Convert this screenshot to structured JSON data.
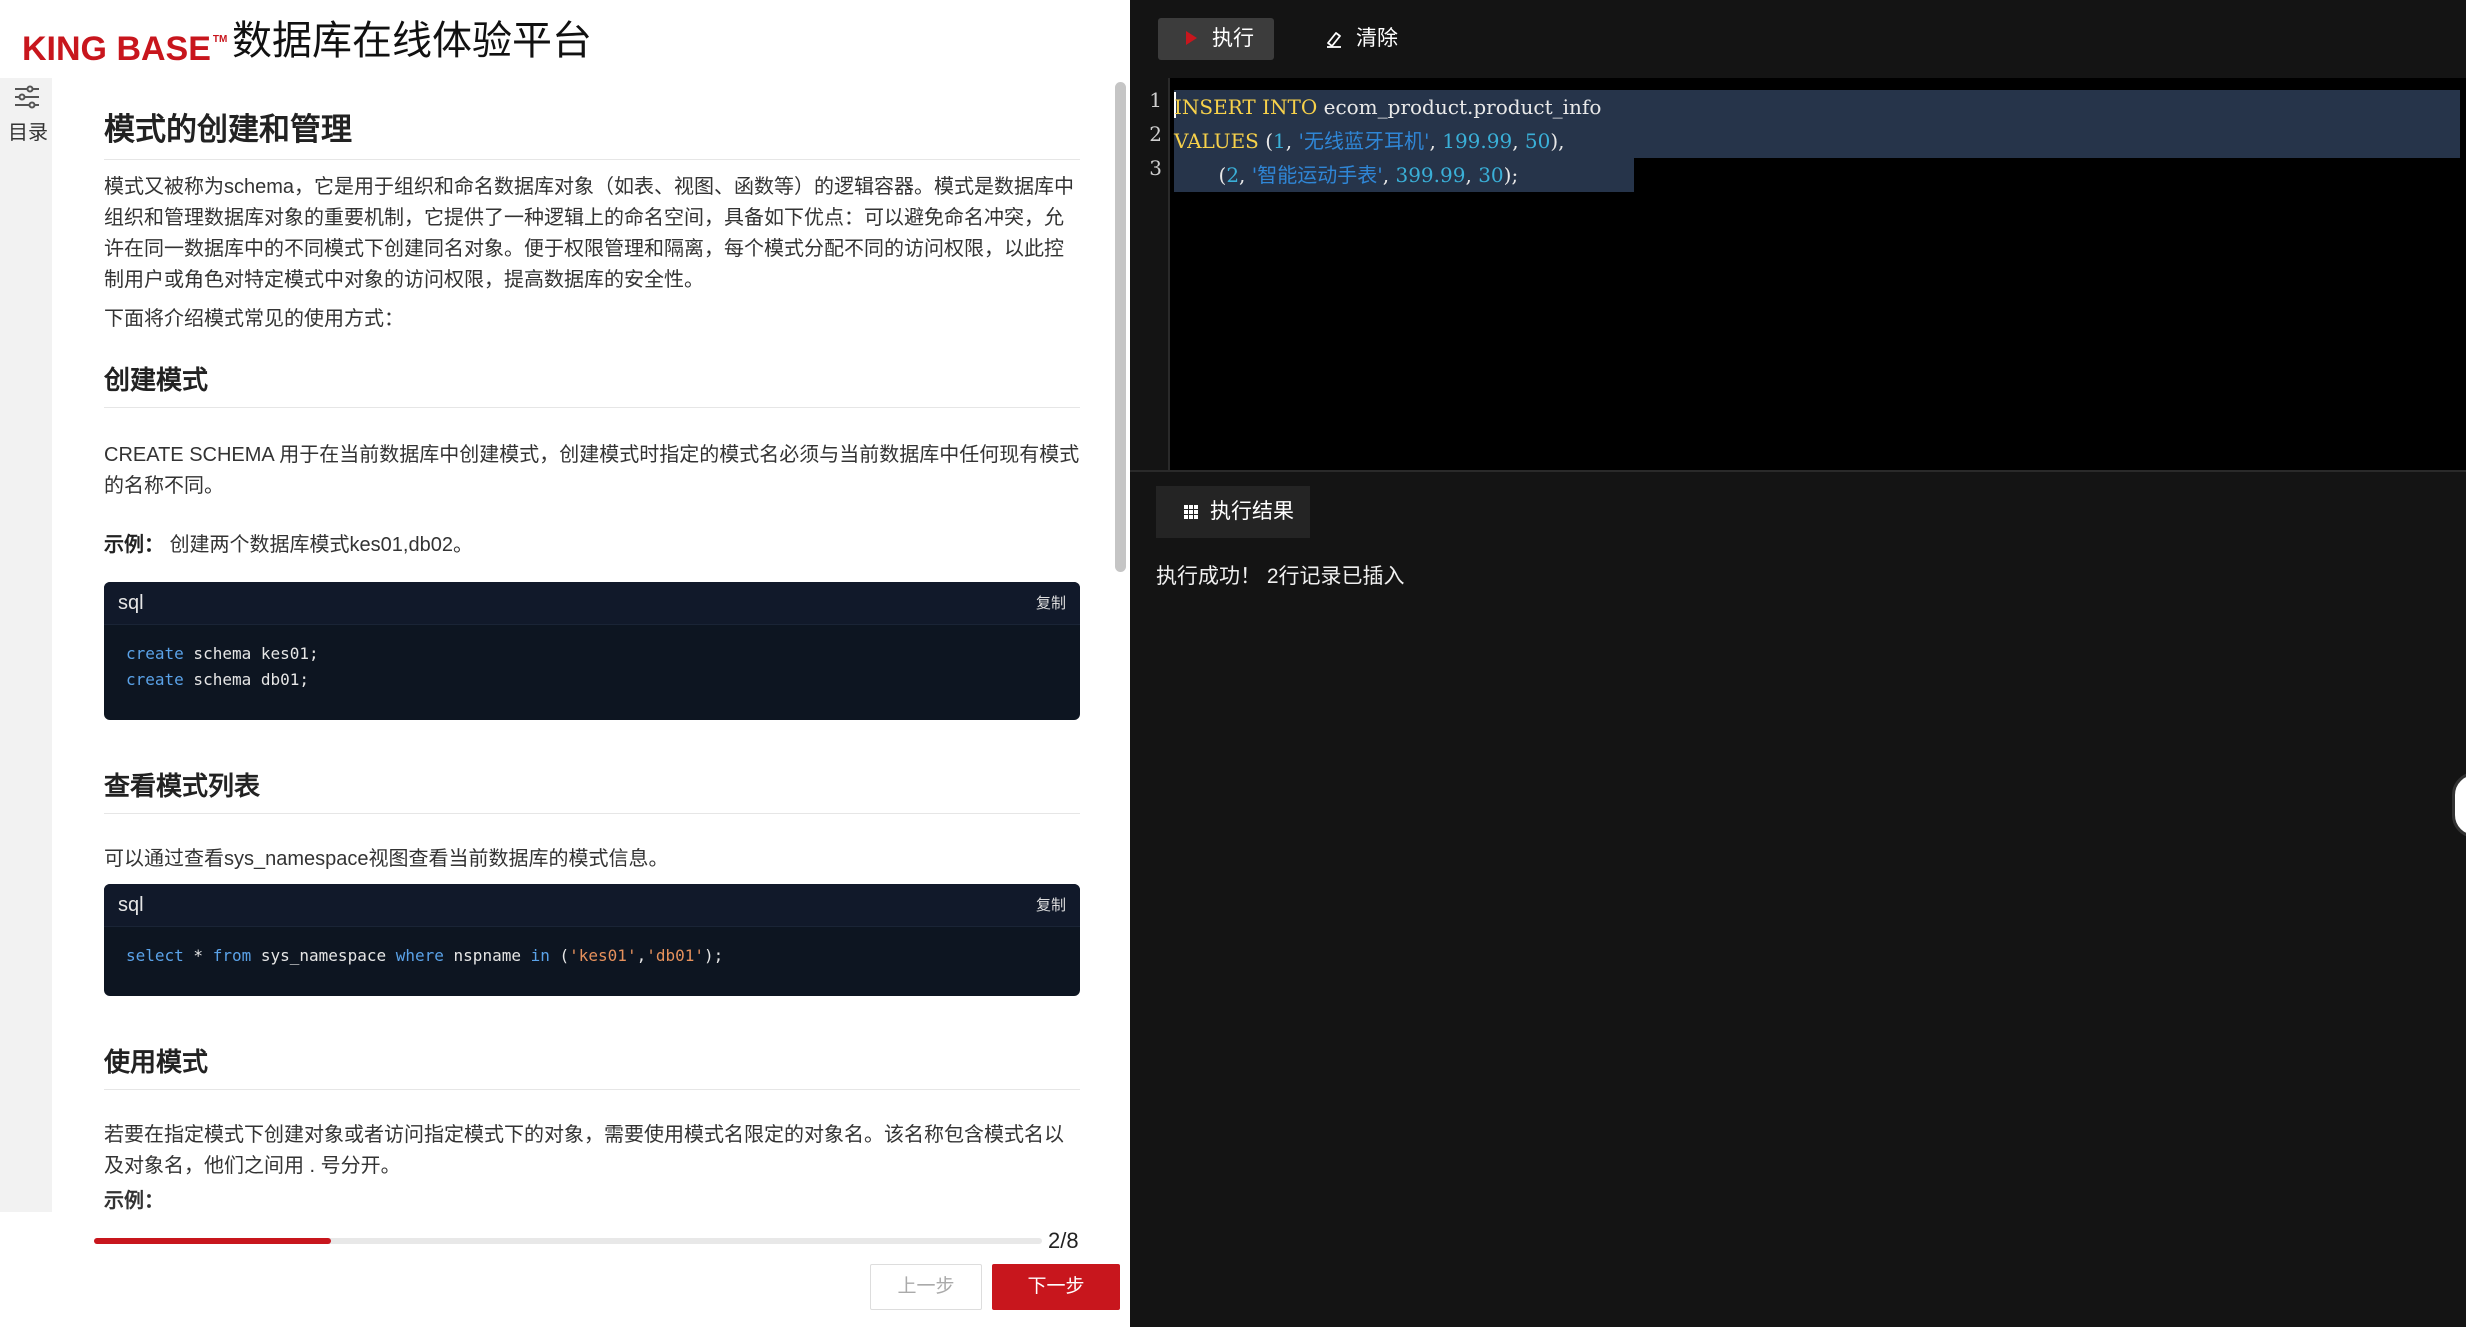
{
  "brand": {
    "logo_text": "KING BASE",
    "logo_tm": "TM",
    "app_title": "数据库在线体验平台"
  },
  "toc": {
    "label": "目录",
    "icon": "sliders-icon"
  },
  "doc": {
    "title": "模式的创建和管理",
    "intro": "模式又被称为schema，它是用于组织和命名数据库对象（如表、视图、函数等）的逻辑容器。模式是数据库中组织和管理数据库对象的重要机制，它提供了一种逻辑上的命名空间，具备如下优点：可以避免命名冲突，允许在同一数据库中的不同模式下创建同名对象。便于权限管理和隔离，每个模式分配不同的访问权限，以此控制用户或角色对特定模式中对象的访问权限，提高数据库的安全性。",
    "intro2": "下面将介绍模式常见的使用方式：",
    "sections": [
      {
        "heading": "创建模式",
        "text": "CREATE SCHEMA 用于在当前数据库中创建模式，创建模式时指定的模式名必须与当前数据库中任何现有模式的名称不同。",
        "example_label": "示例：",
        "example_text": "创建两个数据库模式kes01,db02。",
        "code_lang": "sql",
        "copy_label": "复制",
        "code_lines": [
          {
            "kw": "create",
            "rest": " schema kes01;"
          },
          {
            "kw": "create",
            "rest": " schema db01;"
          }
        ]
      },
      {
        "heading": "查看模式列表",
        "text": "可以通过查看sys_namespace视图查看当前数据库的模式信息。",
        "code_lang": "sql",
        "copy_label": "复制",
        "code": {
          "p1_kw": "select",
          "p2": " * ",
          "p3_kw": "from",
          "p4": " sys_namespace ",
          "p5_kw": "where",
          "p6": " nspname ",
          "p7_kw": "in",
          "p8": " (",
          "p9_str": "'kes01'",
          "p10": ",",
          "p11_str": "'db01'",
          "p12": ");"
        }
      },
      {
        "heading": "使用模式",
        "text": "若要在指定模式下创建对象或者访问指定模式下的对象，需要使用模式名限定的对象名。该名称包含模式名以及对象名，他们之间用 . 号分开。",
        "example_label": "示例："
      }
    ]
  },
  "progress": {
    "current": 2,
    "total": 8,
    "label": "2/8",
    "fraction": 0.25
  },
  "nav": {
    "prev_label": "上一步",
    "next_label": "下一步"
  },
  "toolbar": {
    "run_label": "执行",
    "clear_label": "清除"
  },
  "editor": {
    "line_numbers": [
      "1",
      "2",
      "3"
    ],
    "line1": {
      "kw1": "INSERT",
      "sp1": " ",
      "kw2": "INTO",
      "rest": " ecom_product.product_info"
    },
    "line2": {
      "kw": "VALUES",
      "a": " (",
      "n1": "1",
      "b": ", ",
      "s1": "'无线蓝牙耳机'",
      "c": ", ",
      "n2": "199.99",
      "d": ", ",
      "n3": "50",
      "e": "),"
    },
    "line3": {
      "indent": "       (",
      "n1": "2",
      "b": ", ",
      "s1": "'智能运动手表'",
      "c": ", ",
      "n2": "399.99",
      "d": ", ",
      "n3": "30",
      "e": ");"
    }
  },
  "results": {
    "tab_label": "执行结果",
    "message": "执行成功！ 2行记录已插入"
  },
  "colors": {
    "brand_red": "#c8161d",
    "editor_bg": "#000000",
    "panel_bg": "#141414"
  }
}
